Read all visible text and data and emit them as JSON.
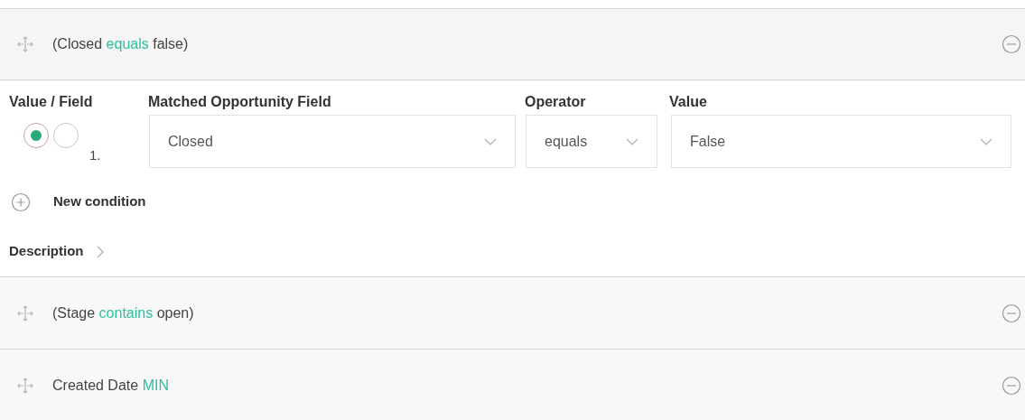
{
  "groups": [
    {
      "title": [
        {
          "kind": "plain",
          "text": "(Closed"
        },
        {
          "kind": "keyword",
          "text": "equals"
        },
        {
          "kind": "plain",
          "text": "false)"
        }
      ],
      "expanded": true,
      "editor": {
        "mode_label": "Value / Field",
        "modes": [
          {
            "selected": true
          },
          {
            "selected": false
          }
        ],
        "index": "1.",
        "field": {
          "label": "Matched Opportunity Field",
          "value": "Closed"
        },
        "operator": {
          "label": "Operator",
          "value": "equals"
        },
        "value": {
          "label": "Value",
          "value": "False"
        }
      },
      "new_condition": "New condition",
      "description": "Description"
    },
    {
      "title": [
        {
          "kind": "plain",
          "text": "(Stage"
        },
        {
          "kind": "keyword",
          "text": "contains"
        },
        {
          "kind": "plain",
          "text": "open)"
        }
      ],
      "expanded": false
    },
    {
      "title": [
        {
          "kind": "plain",
          "text": "Created Date"
        },
        {
          "kind": "keyword",
          "text": "MIN"
        }
      ],
      "expanded": false
    }
  ]
}
